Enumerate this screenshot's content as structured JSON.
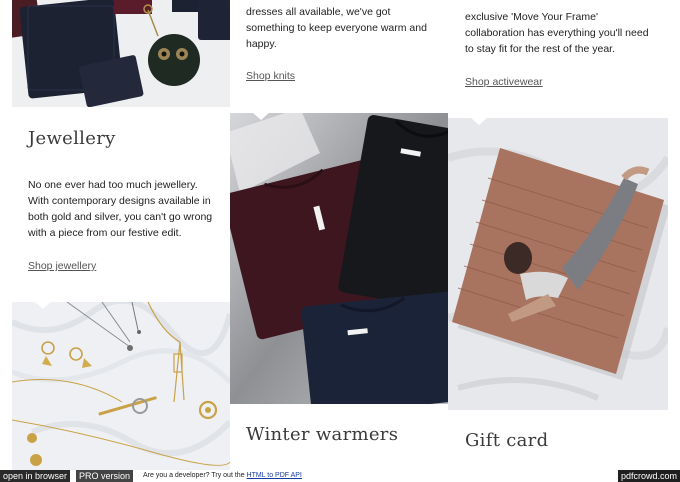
{
  "columns": {
    "col1": {
      "jewellery": {
        "title": "Jewellery",
        "body_line1": "No one ever had too much jewellery.",
        "body_line2": "With contemporary designs available in",
        "body_line3": "both gold and silver, you can't go wrong",
        "body_line4": "with a piece from our festive edit.",
        "link": "Shop jewellery"
      }
    },
    "col2": {
      "knits": {
        "body_line1": "dresses all available, we've got",
        "body_line2": "something to keep everyone warm and",
        "body_line3": "happy.",
        "link": "Shop knits"
      },
      "winter": {
        "title": "Winter warmers"
      }
    },
    "col3": {
      "activewear": {
        "body_line1": "exclusive 'Move Your Frame'",
        "body_line2": "collaboration has everything you'll need",
        "body_line3": "to stay fit for the rest of the year.",
        "link": "Shop activewear"
      },
      "gift": {
        "title": "Gift card"
      }
    }
  },
  "footer": {
    "open_label": "open in browser",
    "pro_label": "PRO version",
    "dev_text": "Are you a developer? Try out the",
    "dev_link": "HTML to PDF API",
    "brand": "pdfcrowd.com"
  },
  "colors": {
    "text": "#2b2b2b",
    "link": "#555555",
    "footer_bg": "#2a2a2a"
  }
}
